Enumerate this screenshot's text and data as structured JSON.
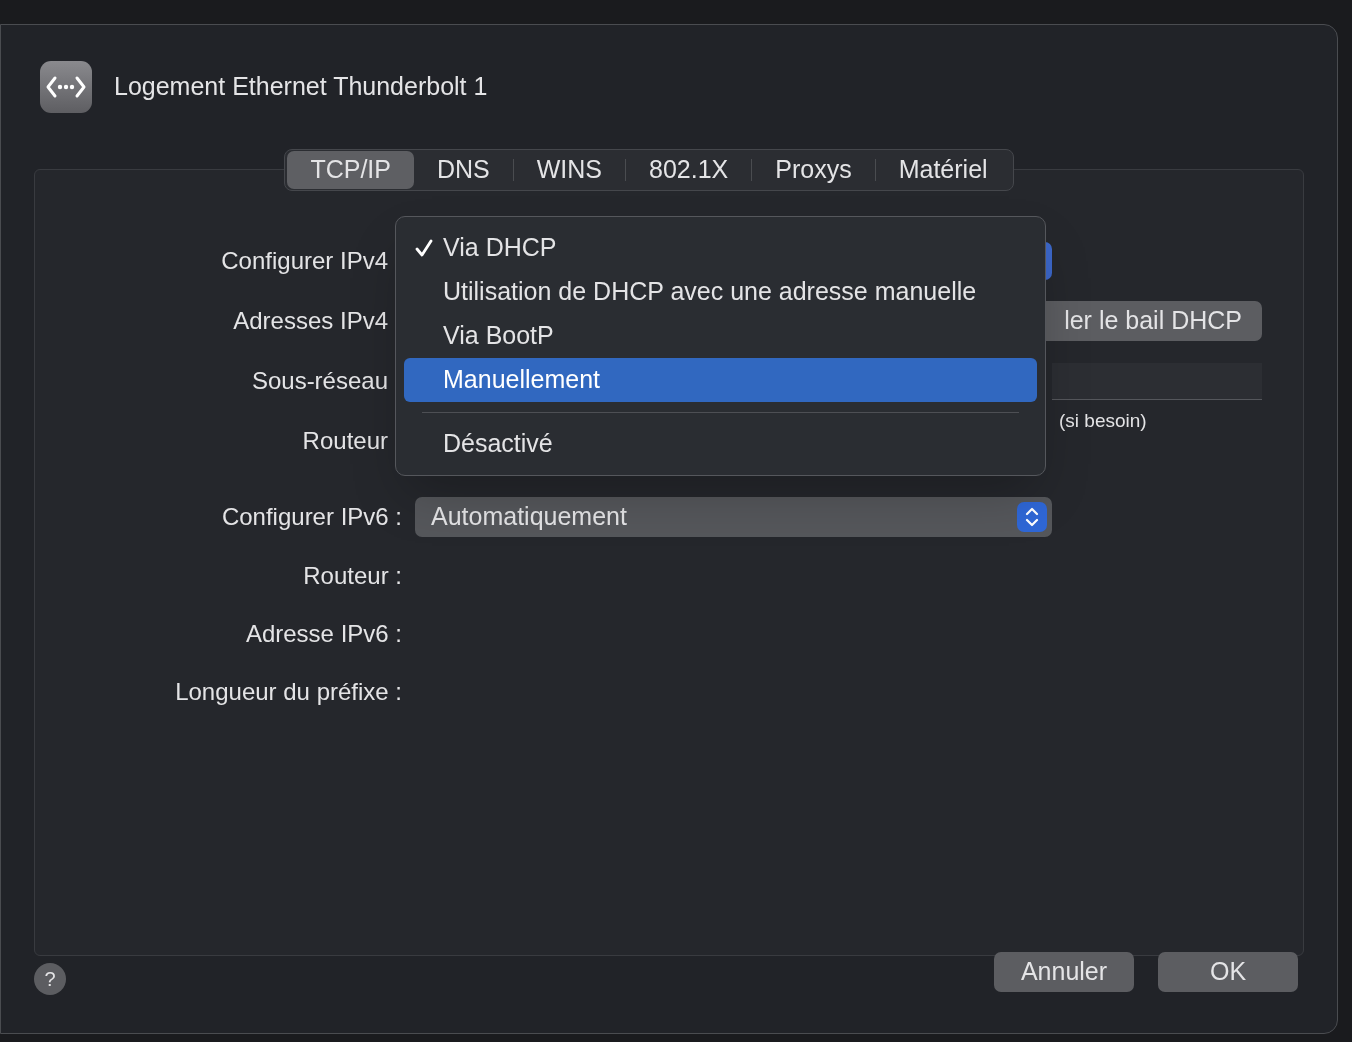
{
  "window": {
    "title": "Logement Ethernet Thunderbolt 1"
  },
  "tabs": [
    {
      "label": "TCP/IP",
      "selected": true
    },
    {
      "label": "DNS",
      "selected": false
    },
    {
      "label": "WINS",
      "selected": false
    },
    {
      "label": "802.1X",
      "selected": false
    },
    {
      "label": "Proxys",
      "selected": false
    },
    {
      "label": "Matériel",
      "selected": false
    }
  ],
  "ipv4": {
    "labels": [
      "Configurer IPv4",
      "Adresses IPv4",
      "Sous-réseau",
      "Routeur"
    ],
    "renew_button": "ler le bail DHCP",
    "hint": "(si besoin)"
  },
  "ipv6": {
    "configure_label": "Configurer IPv6 :",
    "configure_value": "Automatiquement",
    "labels": [
      "Routeur :",
      "Adresse IPv6 :",
      "Longueur du préfixe :"
    ]
  },
  "menu": [
    {
      "kind": "item",
      "label": "Via DHCP",
      "checked": true,
      "selected": false
    },
    {
      "kind": "item",
      "label": "Utilisation de DHCP avec une adresse manuelle",
      "checked": false,
      "selected": false
    },
    {
      "kind": "item",
      "label": "Via BootP",
      "checked": false,
      "selected": false
    },
    {
      "kind": "item",
      "label": "Manuellement",
      "checked": false,
      "selected": true
    },
    {
      "kind": "separator"
    },
    {
      "kind": "item",
      "label": "Désactivé",
      "checked": false,
      "selected": false
    }
  ],
  "buttons": {
    "help": "?",
    "cancel": "Annuler",
    "ok": "OK"
  }
}
